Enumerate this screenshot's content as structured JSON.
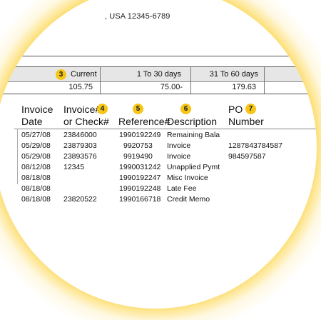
{
  "address_line": ", USA 12345-6789",
  "badges": {
    "b3": "3",
    "b4": "4",
    "b5": "5",
    "b6": "6",
    "b7": "7"
  },
  "aging": {
    "headers": [
      "Current",
      "1 To 30 days",
      "31 To 60 days"
    ],
    "values": [
      "105.75",
      "75.00-",
      "179.63"
    ]
  },
  "table": {
    "headers": [
      {
        "l1": "Invoice",
        "l2": "Date"
      },
      {
        "l1": "Invoice#",
        "l2": "or Check#"
      },
      {
        "l1": "Reference#"
      },
      {
        "l1": "Description"
      },
      {
        "l1": "PO",
        "l2": "Number"
      }
    ],
    "rows": [
      [
        "05/27/08",
        "23846000",
        "1990192249",
        "Remaining Bala",
        ""
      ],
      [
        "05/29/08",
        "23879303",
        "9920753",
        "Invoice",
        "1287843784587"
      ],
      [
        "05/29/08",
        "23893576",
        "9919490",
        "Invoice",
        "984597587"
      ],
      [
        "08/12/08",
        "12345",
        "1990031242",
        "Unapplied Pymt",
        ""
      ],
      [
        "08/18/08",
        "",
        "1990192247",
        "Misc Invoice",
        ""
      ],
      [
        "08/18/08",
        "",
        "1990192248",
        "Late Fee",
        ""
      ],
      [
        "08/18/08",
        "23820522",
        "1990166718",
        "Credit Memo",
        ""
      ]
    ]
  }
}
